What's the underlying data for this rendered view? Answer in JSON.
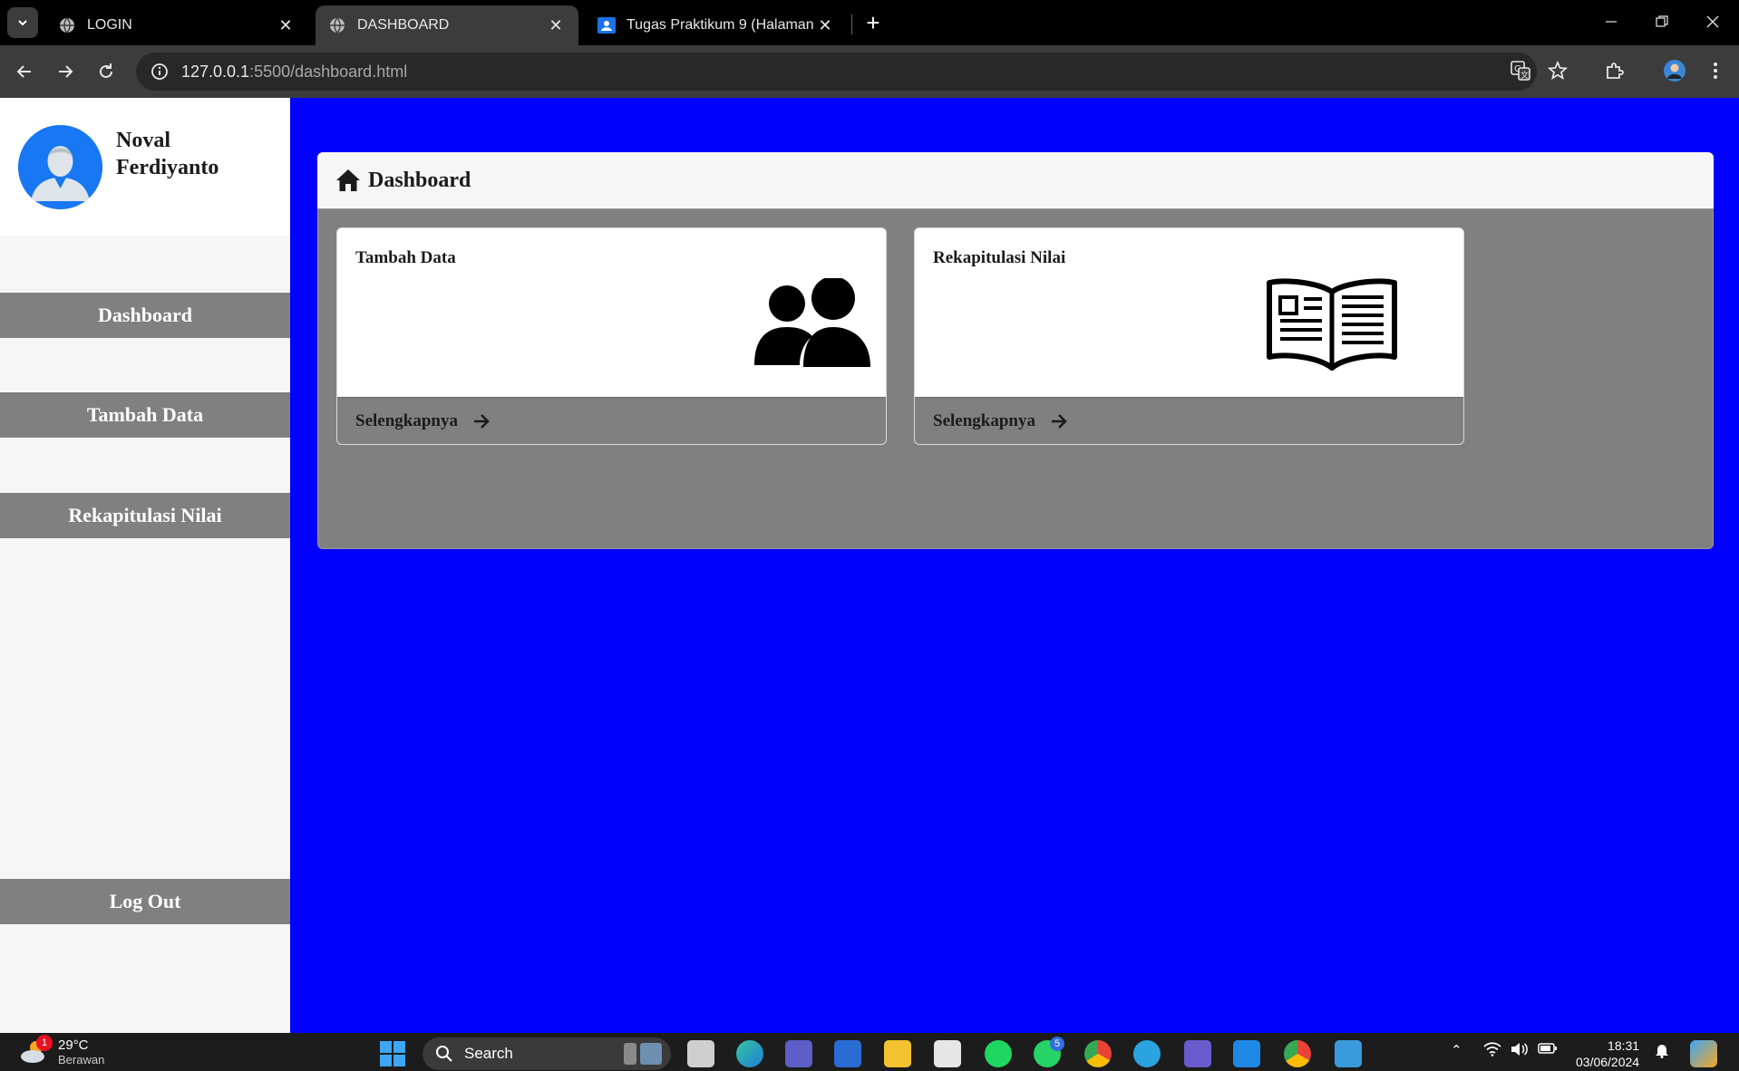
{
  "browser": {
    "tabs": [
      {
        "title": "LOGIN"
      },
      {
        "title": "DASHBOARD"
      },
      {
        "title": "Tugas Praktikum 9 (Halaman da"
      }
    ],
    "url_host": "127.0.0.1",
    "url_rest": ":5500/dashboard.html"
  },
  "sidebar": {
    "user_first": "Noval",
    "user_last": "Ferdiyanto",
    "items": [
      {
        "label": "Dashboard"
      },
      {
        "label": "Tambah Data"
      },
      {
        "label": "Rekapitulasi Nilai"
      }
    ],
    "logout_label": "Log Out"
  },
  "main": {
    "title": "Dashboard",
    "cards": [
      {
        "title": "Tambah Data",
        "link": "Selengkapnya",
        "icon": "users-icon"
      },
      {
        "title": "Rekapitulasi Nilai",
        "link": "Selengkapnya",
        "icon": "open-book-icon"
      }
    ]
  },
  "colors": {
    "page_bg": "#0000ff",
    "sidebar_item": "#808080",
    "panel_body": "#808080"
  },
  "taskbar": {
    "temperature": "29°C",
    "condition": "Berawan",
    "weather_badge": "1",
    "search_placeholder": "Search",
    "whatsapp_badge": "5",
    "time": "18:31",
    "date": "03/06/2024"
  }
}
